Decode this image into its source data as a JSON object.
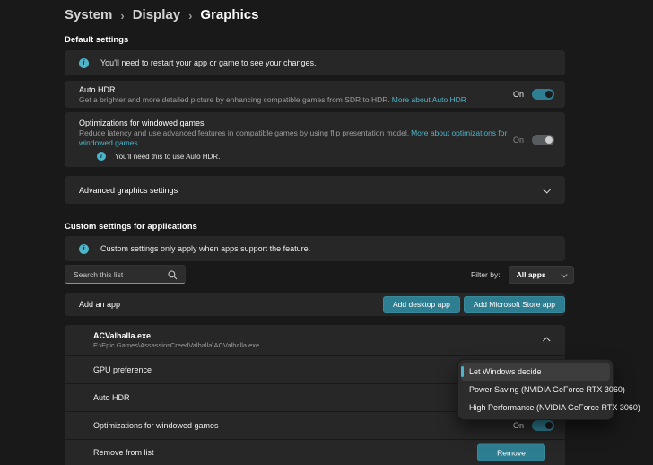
{
  "colors": {
    "accent": "#2e7f94",
    "link": "#4db4c9",
    "page_bg": "#191919",
    "card_bg": "#272727"
  },
  "icons": {
    "info_glyph": "i"
  },
  "breadcrumb": {
    "separator": "›",
    "items": [
      "System",
      "Display",
      "Graphics"
    ]
  },
  "default_settings": {
    "heading": "Default settings",
    "restart_notice": "You'll need to restart your app or game to see your changes.",
    "auto_hdr": {
      "title": "Auto HDR",
      "description": "Get a brighter and more detailed picture by enhancing compatible games from SDR to HDR.",
      "link_label": "More about Auto HDR",
      "state": "On"
    },
    "windowed_optimizations": {
      "title": "Optimizations for windowed games",
      "description": "Reduce latency and use advanced features in compatible games by using flip presentation model.",
      "link_label": "More about optimizations for windowed games",
      "state": "On",
      "note": "You'll need this to use Auto HDR."
    },
    "advanced_label": "Advanced graphics settings"
  },
  "custom_settings": {
    "heading": "Custom settings for applications",
    "support_notice": "Custom settings only apply when apps support the feature.",
    "search_placeholder": "Search this list",
    "filter_label": "Filter by:",
    "filter_value": "All apps",
    "add_app_label": "Add an app",
    "add_desktop_button": "Add desktop app",
    "add_store_button": "Add Microsoft Store app",
    "app": {
      "name": "ACValhalla.exe",
      "path": "E:\\Epic Games\\AssassinsCreedValhalla\\ACValhalla.exe",
      "gpu_preference_label": "GPU preference",
      "auto_hdr_label": "Auto HDR",
      "windowed_label": "Optimizations for windowed games",
      "windowed_state": "On",
      "remove_label": "Remove from list",
      "remove_button": "Remove",
      "gpu_menu": {
        "options": [
          "Let Windows decide",
          "Power Saving (NVIDIA GeForce RTX 3060)",
          "High Performance (NVIDIA GeForce RTX 3060)"
        ],
        "selected": "Let Windows decide"
      }
    }
  }
}
